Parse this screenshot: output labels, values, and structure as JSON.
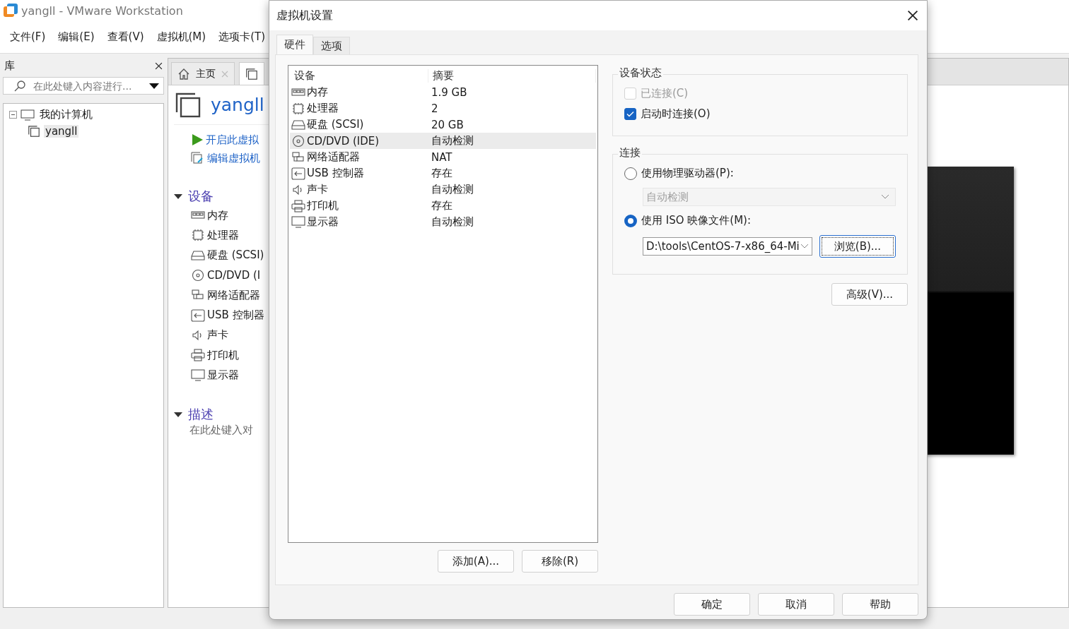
{
  "app": {
    "title": "yangll - VMware Workstation",
    "menu": [
      "文件(F)",
      "编辑(E)",
      "查看(V)",
      "虚拟机(M)",
      "选项卡(T)"
    ]
  },
  "library": {
    "title": "库",
    "search": {
      "placeholder": "在此处键入内容进行..."
    },
    "tree": [
      {
        "label": "我的计算机",
        "expanded": true,
        "children": [
          {
            "label": "yangll",
            "selected": true
          }
        ]
      }
    ]
  },
  "main": {
    "tabs": [
      {
        "kind": "home",
        "label": "主页",
        "selected": false
      },
      {
        "kind": "vm",
        "selected": true
      }
    ],
    "vm_name": "yangll",
    "actions": [
      {
        "kind": "power",
        "label": "开启此虚拟"
      },
      {
        "kind": "edit",
        "label": "编辑虚拟机"
      }
    ],
    "devices_section": {
      "title": "设备",
      "expanded": true,
      "items": [
        {
          "kind": "memory",
          "label": "内存"
        },
        {
          "kind": "cpu",
          "label": "处理器"
        },
        {
          "kind": "disk",
          "label": "硬盘 (SCSI)"
        },
        {
          "kind": "cdrom",
          "label": "CD/DVD (I"
        },
        {
          "kind": "network",
          "label": "网络适配器"
        },
        {
          "kind": "usb",
          "label": "USB 控制器"
        },
        {
          "kind": "sound",
          "label": "声卡"
        },
        {
          "kind": "printer",
          "label": "打印机"
        },
        {
          "kind": "display",
          "label": "显示器"
        }
      ]
    },
    "description_section": {
      "title": "描述",
      "expanded": true,
      "text": "在此处键入对"
    }
  },
  "dialog": {
    "title": "虚拟机设置",
    "tabs": [
      {
        "label": "硬件",
        "selected": true
      },
      {
        "label": "选项",
        "selected": false
      }
    ],
    "device_table": {
      "columns": [
        "设备",
        "摘要"
      ],
      "rows": [
        {
          "kind": "memory",
          "device": "内存",
          "summary": "1.9 GB",
          "selected": false
        },
        {
          "kind": "cpu",
          "device": "处理器",
          "summary": "2",
          "selected": false
        },
        {
          "kind": "disk",
          "device": "硬盘 (SCSI)",
          "summary": "20 GB",
          "selected": false
        },
        {
          "kind": "cdrom",
          "device": "CD/DVD (IDE)",
          "summary": "自动检测",
          "selected": true
        },
        {
          "kind": "network",
          "device": "网络适配器",
          "summary": "NAT",
          "selected": false
        },
        {
          "kind": "usb",
          "device": "USB 控制器",
          "summary": "存在",
          "selected": false
        },
        {
          "kind": "sound",
          "device": "声卡",
          "summary": "自动检测",
          "selected": false
        },
        {
          "kind": "printer",
          "device": "打印机",
          "summary": "存在",
          "selected": false
        },
        {
          "kind": "display",
          "device": "显示器",
          "summary": "自动检测",
          "selected": false
        }
      ]
    },
    "table_buttons": [
      "添加(A)...",
      "移除(R)"
    ],
    "device_status": {
      "title": "设备状态",
      "options": [
        {
          "label": "已连接(C)",
          "checked": false,
          "disabled": true
        },
        {
          "label": "启动时连接(O)",
          "checked": true,
          "disabled": false
        }
      ]
    },
    "connection": {
      "title": "连接",
      "physical": {
        "label": "使用物理驱动器(P):",
        "selected": false,
        "drive": {
          "value": "自动检测",
          "disabled": true
        }
      },
      "iso": {
        "label": "使用 ISO 映像文件(M):",
        "selected": true,
        "path": "D:\\tools\\CentOS-7-x86_64-Mi",
        "browse": "浏览(B)..."
      }
    },
    "advanced": "高级(V)...",
    "buttons": [
      "确定",
      "取消",
      "帮助"
    ]
  }
}
